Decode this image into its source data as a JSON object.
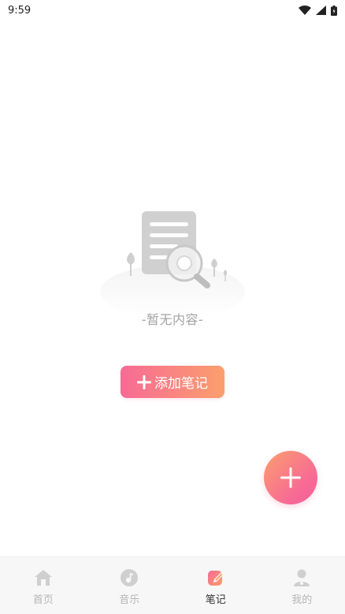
{
  "status_bar": {
    "time": "9:59",
    "icons": [
      "wifi-icon",
      "cellular-signal-icon",
      "battery-icon"
    ]
  },
  "empty_state": {
    "text": "-暂无内容-",
    "icon": "document-search-illustration"
  },
  "add_note_button": {
    "label": "添加笔记",
    "icon": "plus-icon"
  },
  "fab": {
    "icon": "plus-icon"
  },
  "bottom_nav": {
    "items": [
      {
        "label": "首页",
        "icon": "home-icon",
        "active": false
      },
      {
        "label": "音乐",
        "icon": "music-icon",
        "active": false
      },
      {
        "label": "笔记",
        "icon": "note-icon",
        "active": true
      },
      {
        "label": "我的",
        "icon": "user-icon",
        "active": false
      }
    ]
  },
  "colors": {
    "gradient_start": "#f76a95",
    "gradient_end": "#fb9f6d",
    "inactive_text": "#b6b6b6",
    "active_text": "#333333"
  }
}
